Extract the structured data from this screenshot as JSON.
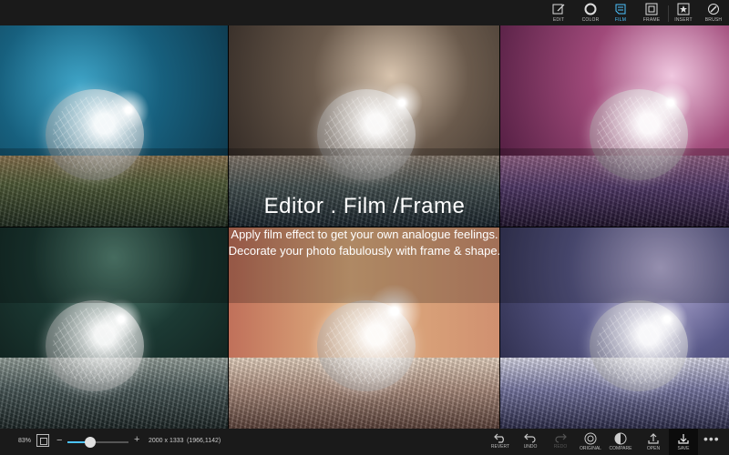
{
  "toolbar": {
    "items": [
      {
        "label": "EDIT",
        "icon": "edit-icon"
      },
      {
        "label": "COLOR",
        "icon": "color-icon"
      },
      {
        "label": "FILM",
        "icon": "film-icon",
        "active": true
      },
      {
        "label": "FRAME",
        "icon": "frame-icon"
      },
      {
        "label": "INSERT",
        "icon": "insert-icon"
      },
      {
        "label": "BRUSH",
        "icon": "brush-icon"
      }
    ],
    "accent": "#4cc3ff"
  },
  "promo": {
    "title": "Editor . Film /Frame",
    "line1": "Apply film effect to get your own analogue feelings.",
    "line2": "Decorate your photo fabulously with frame & shape."
  },
  "tiles": [
    {
      "tint": "teal-blue",
      "palette": [
        "#0f4f6a",
        "#2b8fb0",
        "#c8a07a",
        "#5a6a3a"
      ]
    },
    {
      "tint": "warm-sepia",
      "palette": [
        "#2a2420",
        "#6a5a4c",
        "#d8c6b0",
        "#3a4a5a"
      ]
    },
    {
      "tint": "magenta-violet",
      "palette": [
        "#4a1a3a",
        "#a04a7a",
        "#e0b0d0",
        "#5a3a7a"
      ]
    },
    {
      "tint": "dark-green",
      "palette": [
        "#10201e",
        "#3a6a5a",
        "#cfd8d0",
        "#2a4040"
      ]
    },
    {
      "tint": "vintage-orange",
      "palette": [
        "#5a3a2a",
        "#c07a5a",
        "#f0e0c8",
        "#7a6050"
      ]
    },
    {
      "tint": "cool-purple",
      "palette": [
        "#2a2a4a",
        "#6a6a9a",
        "#e0e0f0",
        "#4a4a7a"
      ]
    }
  ],
  "bottombar": {
    "zoom": "83%",
    "zoom_level": 0.38,
    "dimensions": "2000 x 1333",
    "coords": "(1966,1142)",
    "actions": [
      {
        "label": "REVERT",
        "icon": "revert-icon",
        "enabled": true
      },
      {
        "label": "UNDO",
        "icon": "undo-icon",
        "enabled": true
      },
      {
        "label": "REDO",
        "icon": "redo-icon",
        "enabled": false
      },
      {
        "label": "ORIGINAL",
        "icon": "original-icon",
        "enabled": true
      },
      {
        "label": "COMPARE",
        "icon": "compare-icon",
        "enabled": true
      },
      {
        "label": "OPEN",
        "icon": "open-icon",
        "enabled": true
      },
      {
        "label": "SAVE",
        "icon": "save-icon",
        "enabled": true
      }
    ],
    "more": "•••"
  }
}
